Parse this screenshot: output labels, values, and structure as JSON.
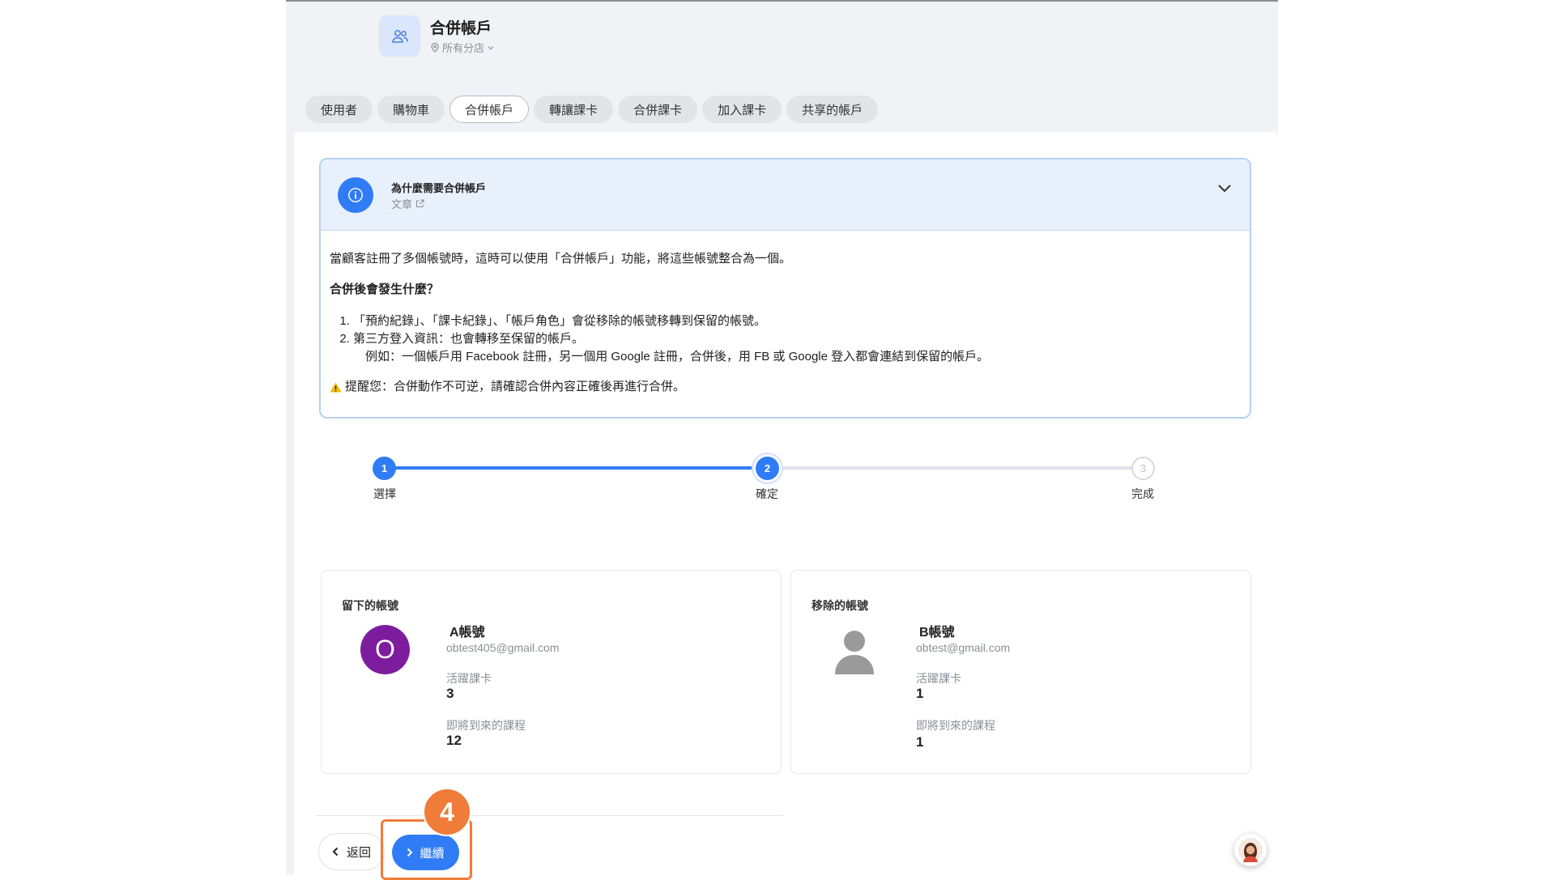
{
  "header": {
    "title": "合併帳戶",
    "location": "所有分店",
    "icon": "users-icon"
  },
  "tabs": [
    {
      "label": "使用者",
      "active": false
    },
    {
      "label": "購物車",
      "active": false
    },
    {
      "label": "合併帳戶",
      "active": true
    },
    {
      "label": "轉讓課卡",
      "active": false
    },
    {
      "label": "合併課卡",
      "active": false
    },
    {
      "label": "加入課卡",
      "active": false
    },
    {
      "label": "共享的帳戶",
      "active": false
    }
  ],
  "info": {
    "title": "為什麼需要合併帳戶",
    "link_label": "文章",
    "intro": "當顧客註冊了多個帳號時，這時可以使用「合併帳戶」功能，將這些帳號整合為一個。",
    "question": "合併後會發生什麼？",
    "items": [
      "「預約紀錄」、「課卡紀錄」、「帳戶角色」會從移除的帳號移轉到保留的帳號。",
      "第三方登入資訊：也會轉移至保留的帳戶。"
    ],
    "example": "例如：一個帳戶用 Facebook 註冊，另一個用 Google 註冊，合併後，用 FB 或 Google 登入都會連結到保留的帳戶。",
    "warning": "提醒您：合併動作不可逆，請確認合併內容正確後再進行合併。"
  },
  "stepper": {
    "steps": [
      {
        "number": "1",
        "label": "選擇",
        "state": "done"
      },
      {
        "number": "2",
        "label": "確定",
        "state": "current"
      },
      {
        "number": "3",
        "label": "完成",
        "state": "todo"
      }
    ],
    "accent": "#2f7cf6"
  },
  "keep_account": {
    "heading": "留下的帳號",
    "avatar_letter": "O",
    "avatar_color": "#7d1d9e",
    "name": "A帳號",
    "email": "obtest405@gmail.com",
    "active_cards_label": "活躍課卡",
    "active_cards": "3",
    "upcoming_label": "即將到來的課程",
    "upcoming": "12"
  },
  "remove_account": {
    "heading": "移除的帳號",
    "name": "B帳號",
    "email": "obtest@gmail.com",
    "active_cards_label": "活躍課卡",
    "active_cards": "1",
    "upcoming_label": "即將到來的課程",
    "upcoming": "1"
  },
  "actions": {
    "back_label": "返回",
    "continue_label": "繼續"
  },
  "annotation": {
    "badge": "4",
    "color": "#f07c3a"
  }
}
